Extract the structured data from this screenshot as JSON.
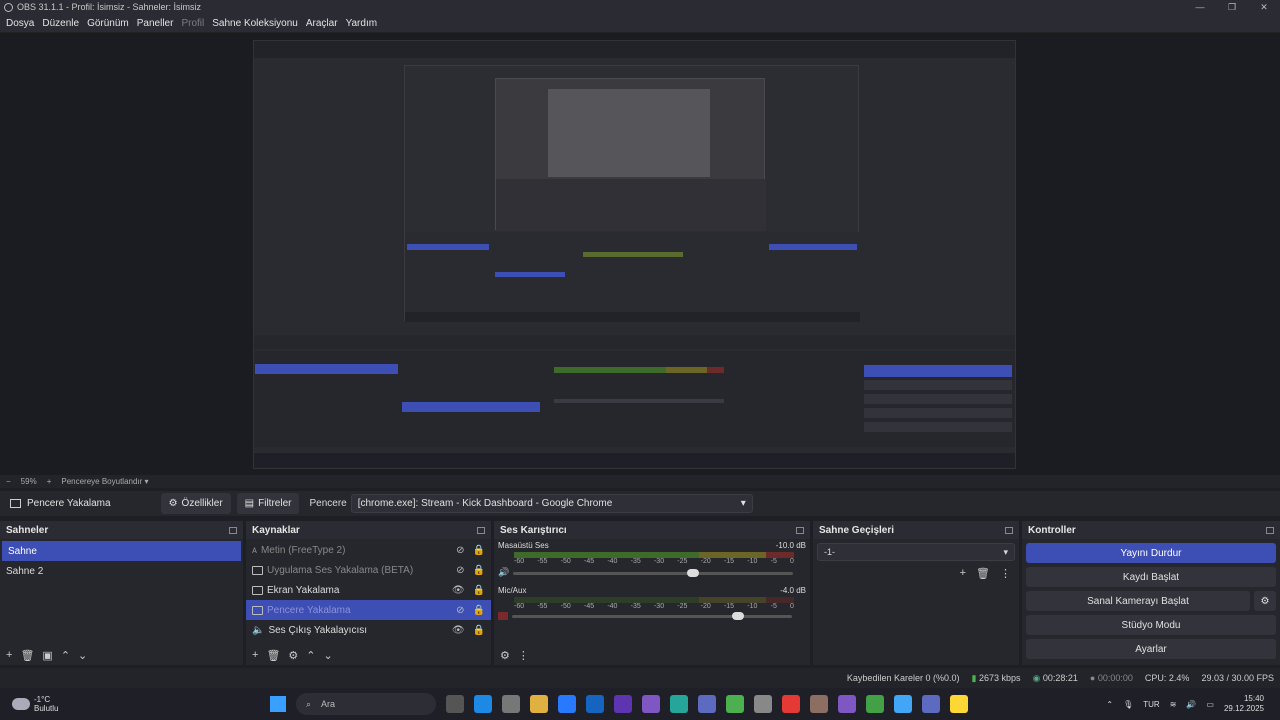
{
  "window": {
    "title": "OBS 31.1.1 - Profil: İsimsiz - Sahneler: İsimsiz"
  },
  "menu": {
    "items": [
      "Dosya",
      "Düzenle",
      "Görünüm",
      "Paneller",
      "Profil",
      "Sahne Koleksiyonu",
      "Araçlar",
      "Yardım"
    ]
  },
  "zoom": {
    "minus": "−",
    "value": "59%",
    "plus": "+",
    "fit_label": "Pencereye Boyutlandır"
  },
  "source_bar": {
    "current_source": "Pencere Yakalama",
    "properties": "Özellikler",
    "filters": "Filtreler",
    "window_label": "Pencere",
    "window_value": "[chrome.exe]: Stream - Kick Dashboard - Google Chrome"
  },
  "scenes": {
    "title": "Sahneler",
    "items": [
      "Sahne",
      "Sahne 2"
    ]
  },
  "sources": {
    "title": "Kaynaklar",
    "items": [
      {
        "label": "Metin (FreeType 2)",
        "hidden": true
      },
      {
        "label": "Uygulama Ses Yakalama (BETA)",
        "hidden": true
      },
      {
        "label": "Ekran Yakalama",
        "hidden": false
      },
      {
        "label": "Pencere Yakalama",
        "hidden": true
      },
      {
        "label": "Ses Çıkış Yakalayıcısı",
        "hidden": false
      }
    ]
  },
  "mixer": {
    "title": "Ses Karıştırıcı",
    "channels": [
      {
        "name": "Masaüstü Ses",
        "db": "-10.0 dB",
        "level": 0.7
      },
      {
        "name": "Mic/Aux",
        "db": "-4.0 dB",
        "level": 0.85
      }
    ],
    "scale": [
      "-60",
      "-55",
      "-50",
      "-45",
      "-40",
      "-35",
      "-30",
      "-25",
      "-20",
      "-15",
      "-10",
      "-5",
      "0"
    ]
  },
  "transitions": {
    "title": "Sahne Geçişleri",
    "selected": "-1-"
  },
  "controls": {
    "title": "Kontroller",
    "stop_stream": "Yayını Durdur",
    "start_record": "Kaydı Başlat",
    "virtual_cam": "Sanal Kamerayı Başlat",
    "studio_mode": "Stüdyo Modu",
    "settings": "Ayarlar"
  },
  "status": {
    "dropped": "Kaybedilen Kareler 0 (%0.0)",
    "bitrate": "2673 kbps",
    "stream_time": "00:28:21",
    "rec_time": "00:00:00",
    "cpu": "CPU: 2.4%",
    "fps": "29.03 / 30.00 FPS"
  },
  "taskbar": {
    "temp": "-1°C",
    "weather": "Bulutlu",
    "search": "Ara",
    "lang": "TUR",
    "time": "15:40",
    "date": "29.12.2025"
  },
  "colors": {
    "accent": "#3d4eb5"
  }
}
